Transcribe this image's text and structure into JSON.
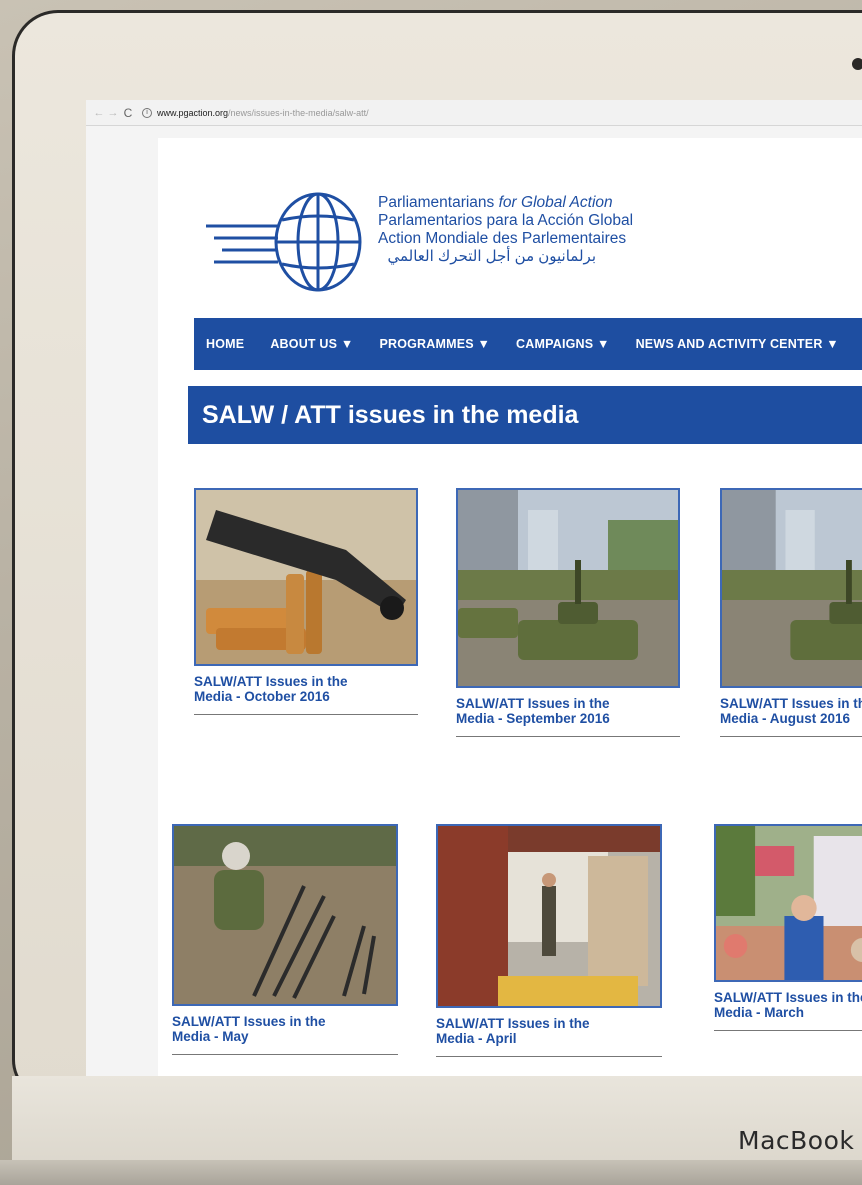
{
  "browser": {
    "url_host": "www.pgaction.org",
    "url_path": "/news/issues-in-the-media/salw-att/"
  },
  "header": {
    "org_en": "Parliamentarians",
    "org_en_italic": "for Global Action",
    "org_es": "Parlamentarios para la Acción Global",
    "org_fr": "Action Mondiale des Parlementaires",
    "org_ar": "برلمانيون من أجل التحرك العالمي"
  },
  "nav": {
    "items": [
      "HOME",
      "ABOUT US ▼",
      "PROGRAMMES ▼",
      "CAMPAIGNS ▼",
      "NEWS AND ACTIVITY CENTER ▼"
    ]
  },
  "page": {
    "title": "SALW / ATT issues in the media"
  },
  "cards": [
    {
      "line1": "SALW/ATT Issues in the",
      "line2": "Media - October 2016"
    },
    {
      "line1": "SALW/ATT Issues in the",
      "line2": "Media - September 2016"
    },
    {
      "line1": "SALW/ATT Issues in the",
      "line2": "Media - August 2016"
    },
    {
      "line1": "SALW/ATT Issues in the",
      "line2": "Media - May"
    },
    {
      "line1": "SALW/ATT Issues in the",
      "line2": "Media - April"
    },
    {
      "line1": "SALW/ATT Issues in the",
      "line2": "Media - March"
    }
  ],
  "device": {
    "label": "MacBook"
  },
  "colors": {
    "brand_blue": "#1e4ea1",
    "link_blue": "#1f4fa3"
  }
}
